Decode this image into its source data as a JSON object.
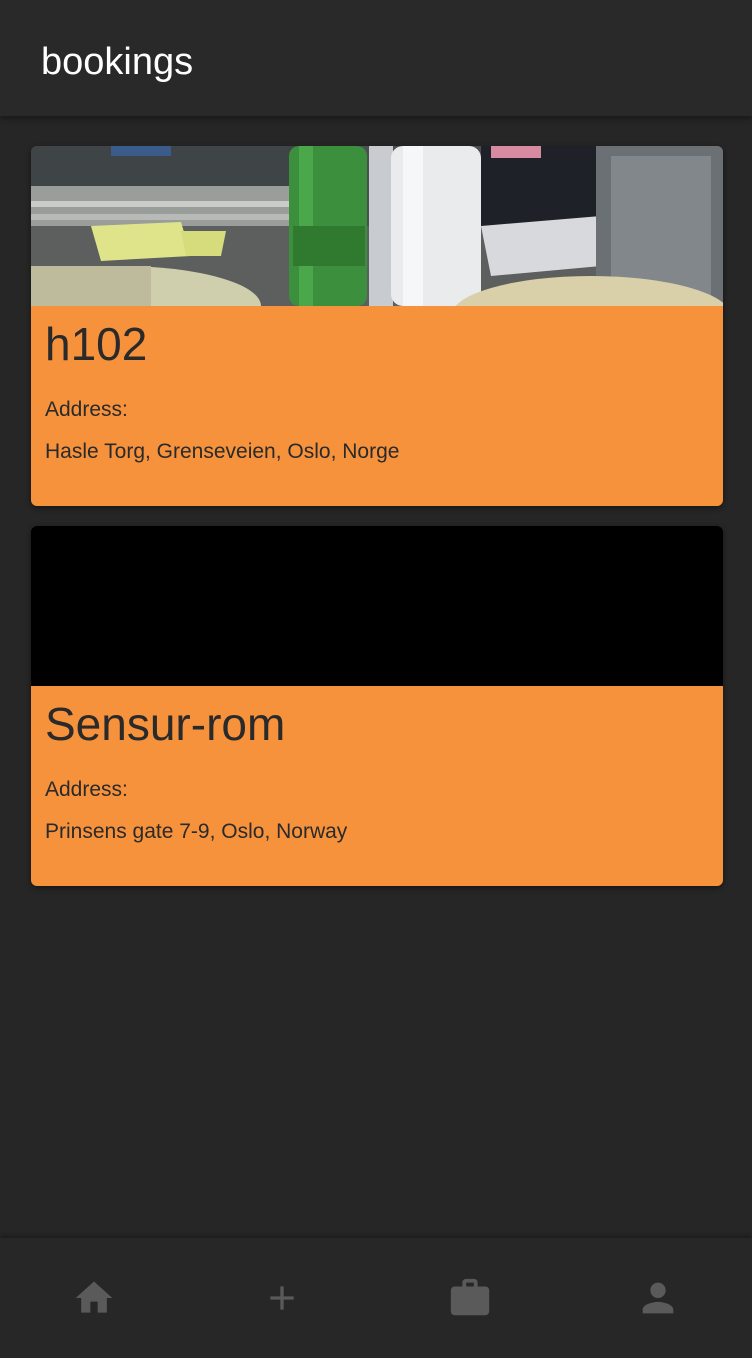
{
  "header": {
    "title": "bookings"
  },
  "bookings": [
    {
      "name": "h102",
      "address_label": "Address:",
      "address": "Hasle Torg, Grenseveien, Oslo, Norge",
      "image": "room-photo"
    },
    {
      "name": "Sensur-rom",
      "address_label": "Address:",
      "address": "Prinsens gate 7-9, Oslo, Norway",
      "image": "black-placeholder"
    }
  ],
  "nav": {
    "items": [
      {
        "icon": "home-icon"
      },
      {
        "icon": "plus-icon"
      },
      {
        "icon": "briefcase-icon"
      },
      {
        "icon": "person-icon"
      }
    ]
  },
  "colors": {
    "background": "#262626",
    "topbar": "#292929",
    "card": "#f7923c",
    "card_text": "#2a2a2a",
    "nav_icon": "#5a5a5a"
  }
}
